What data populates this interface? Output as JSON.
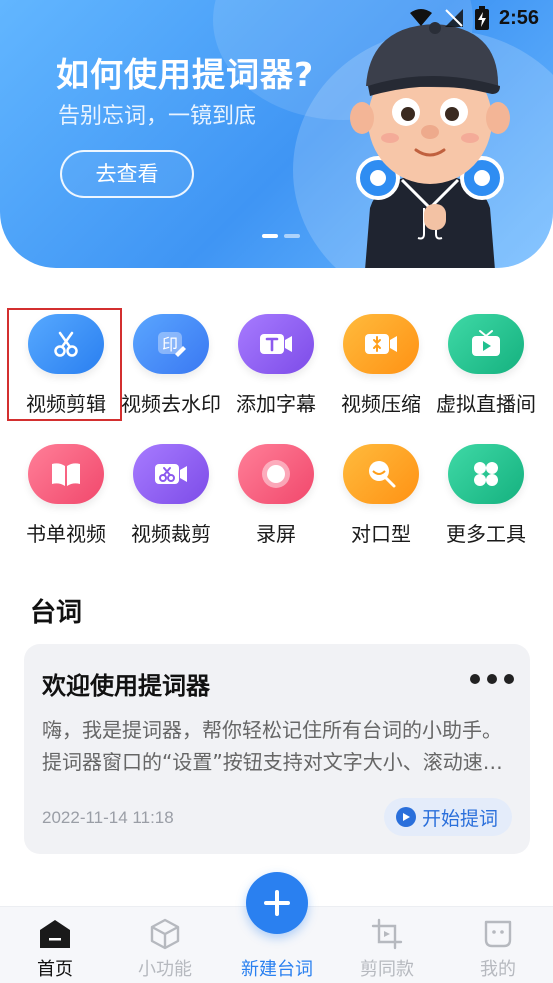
{
  "status_bar": {
    "time": "2:56"
  },
  "banner": {
    "title": "如何使用提词器?",
    "subtitle": "告别忘词，一镜到底",
    "button_label": "去查看"
  },
  "tools": [
    {
      "label": "视频剪辑",
      "icon": "scissors-icon",
      "color": "#2f8df2"
    },
    {
      "label": "视频去水印",
      "icon": "watermark-stamp-icon",
      "color": "#3f86f5"
    },
    {
      "label": "添加字幕",
      "icon": "text-video-icon",
      "color": "#8c59ee"
    },
    {
      "label": "视频压缩",
      "icon": "compress-video-icon",
      "color": "#ff9f1a"
    },
    {
      "label": "虚拟直播间",
      "icon": "tv-play-icon",
      "color": "#21c08f"
    },
    {
      "label": "书单视频",
      "icon": "book-icon",
      "color": "#f6597a"
    },
    {
      "label": "视频裁剪",
      "icon": "crop-video-icon",
      "color": "#8c59ee"
    },
    {
      "label": "录屏",
      "icon": "record-icon",
      "color": "#f6597a"
    },
    {
      "label": "对口型",
      "icon": "lip-sync-icon",
      "color": "#ff9f1a"
    },
    {
      "label": "更多工具",
      "icon": "grid-more-icon",
      "color": "#21c08f"
    }
  ],
  "section": {
    "title": "台词"
  },
  "card": {
    "title": "欢迎使用提词器",
    "body": "嗨，我是提词器，帮你轻松记住所有台词的小助手。提词器窗口的“设置”按钮支持对文字大小、滚动速度等进行调节。",
    "date": "2022-11-14 11:18",
    "start_label": "开始提词"
  },
  "nav": {
    "home": "首页",
    "mini": "小功能",
    "new": "新建台词",
    "template": "剪同款",
    "mine": "我的"
  }
}
